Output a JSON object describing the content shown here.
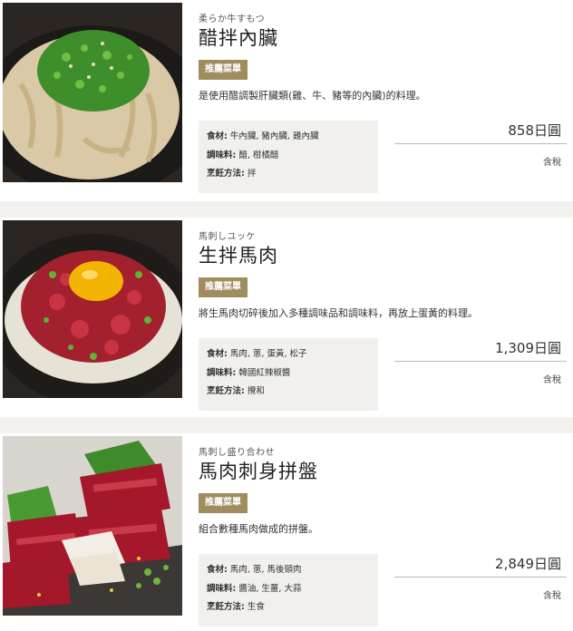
{
  "menu": {
    "items": [
      {
        "subtitle": "柔らか牛すもつ",
        "name": "醋拌內臟",
        "badge": "推薦菜單",
        "description": "是使用醋調製肝臟類(雞、牛、豬等的內臟)的料理。",
        "ingredients_label": "食材",
        "ingredients": "牛內臟, 豬內臟, 雞內臟",
        "seasoning_label": "調味料",
        "seasoning": "醋, 柑橘醋",
        "method_label": "烹飪方法",
        "method": "拌",
        "price": "858日圓",
        "tax": "含稅",
        "image_icon": "tripe-salad-photo"
      },
      {
        "subtitle": "馬刺しユッケ",
        "name": "生拌馬肉",
        "badge": "推薦菜單",
        "description": "將生馬肉切碎後加入多種調味品和調味料，再放上蛋黃的料理。",
        "ingredients_label": "食材",
        "ingredients": "馬肉, 蔥, 蛋黃, 松子",
        "seasoning_label": "調味料",
        "seasoning": "韓國紅辣椒醬",
        "method_label": "烹飪方法",
        "method": "攪和",
        "price": "1,309日圓",
        "tax": "含稅",
        "image_icon": "horse-yukhoe-photo"
      },
      {
        "subtitle": "馬刺し盛り合わせ",
        "name": "馬肉刺身拼盤",
        "badge": "推薦菜單",
        "description": "組合數種馬肉做成的拼盤。",
        "ingredients_label": "食材",
        "ingredients": "馬肉, 蔥, 馬後頸肉",
        "seasoning_label": "調味料",
        "seasoning": "醬油, 生薑, 大蒜",
        "method_label": "烹飪方法",
        "method": "生食",
        "price": "2,849日圓",
        "tax": "含稅",
        "image_icon": "horse-sashimi-platter-photo"
      }
    ]
  },
  "colors": {
    "badge": "#a08d5f",
    "page_background": "#f3f2ef",
    "details_background": "#f1f0ed"
  }
}
